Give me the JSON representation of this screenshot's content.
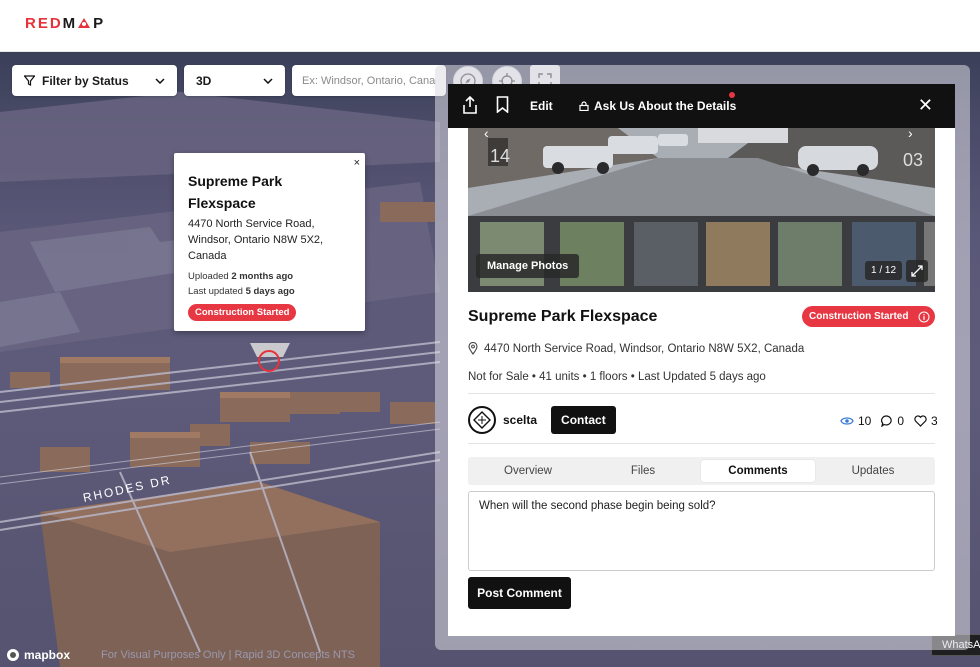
{
  "brand": {
    "logo_a": "RED",
    "logo_b": "M",
    "logo_c": "P",
    "accent": "#e8323a"
  },
  "toolbar": {
    "filter_label": "Filter by Status",
    "view_label": "3D",
    "search_placeholder": "Ex: Windsor, Ontario, Canada"
  },
  "popup": {
    "title_line1": "Supreme Park",
    "title_line2": "Flexspace",
    "address_line1": "4470 North Service Road,",
    "address_line2": "Windsor, Ontario N8W 5X2,",
    "address_line3": "Canada",
    "uploaded_prefix": "Uploaded",
    "uploaded_value": "2 months ago",
    "updated_prefix": "Last updated",
    "updated_value": "5 days ago",
    "status": "Construction Started",
    "close": "×"
  },
  "map": {
    "street_label": "RHODES DR",
    "attribution": "mapbox",
    "disclaimer": "For Visual Purposes Only | Rapid 3D Concepts NTS",
    "whatsapp": "WhatsA"
  },
  "panel": {
    "edit_label": "Edit",
    "ask_label": "Ask Us About the Details",
    "close": "✕",
    "manage_photos": "Manage Photos",
    "photo_counter": "1 / 12",
    "title": "Supreme Park Flexspace",
    "status": "Construction Started",
    "address": "4470 North Service Road, Windsor, Ontario N8W 5X2, Canada",
    "meta": "Not for Sale • 41 units • 1 floors • Last Updated 5 days ago",
    "owner_name": "scelta",
    "contact_label": "Contact",
    "views": "10",
    "comments_count": "0",
    "likes": "3",
    "tabs": [
      "Overview",
      "Files",
      "Comments",
      "Updates"
    ],
    "active_tab": "Comments",
    "comment_text": "When will the second phase begin being sold?",
    "post_label": "Post Comment"
  }
}
